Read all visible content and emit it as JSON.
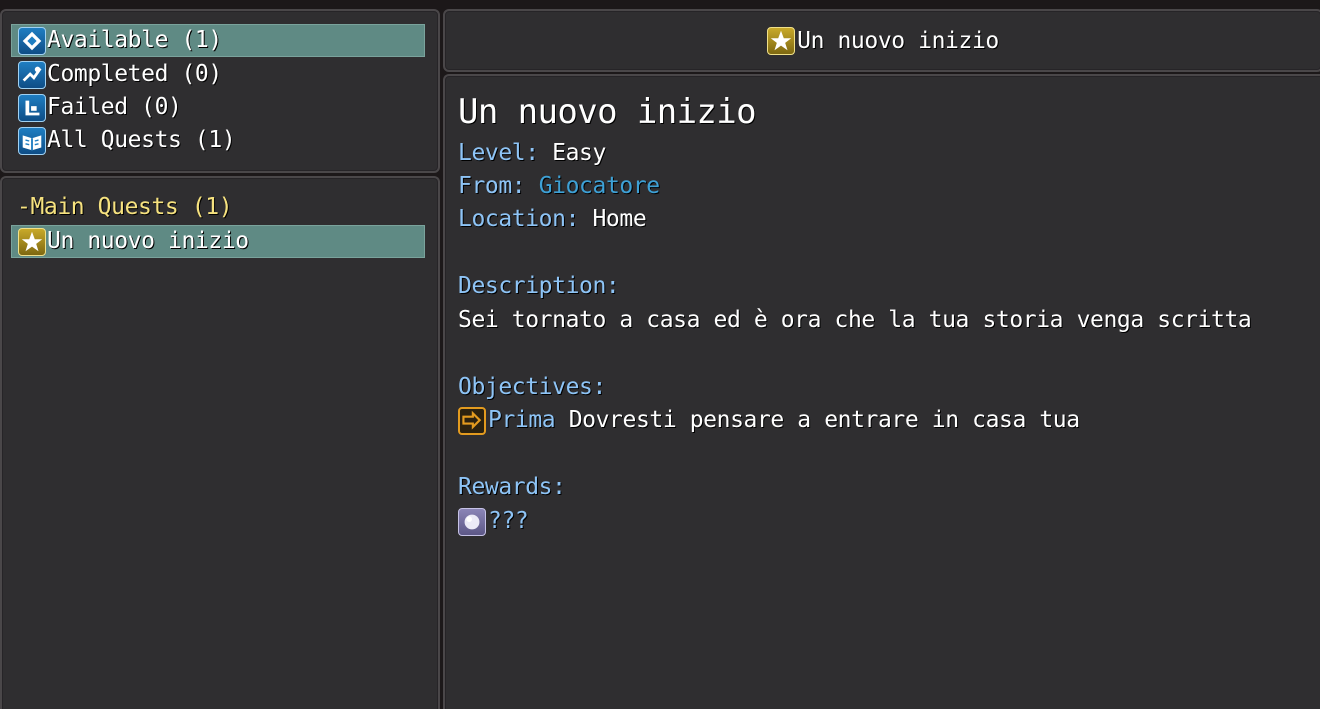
{
  "categories": [
    {
      "icon": "quest-available-icon",
      "label": "Available (1)",
      "selected": true
    },
    {
      "icon": "quest-completed-icon",
      "label": "Completed (0)",
      "selected": false
    },
    {
      "icon": "quest-failed-icon",
      "label": "Failed (0)",
      "selected": false
    },
    {
      "icon": "all-quests-book-icon",
      "label": "All Quests (1)",
      "selected": false
    }
  ],
  "quest_list": {
    "group_header": "-Main Quests (1)",
    "items": [
      {
        "icon": "star-icon",
        "label": "Un nuovo inizio",
        "selected": true
      }
    ]
  },
  "title_bar": {
    "icon": "star-icon",
    "text": "Un nuovo inizio"
  },
  "detail": {
    "title": "Un nuovo inizio",
    "level_label": "Level:",
    "level_value": "Easy",
    "from_label": "From:",
    "from_value": "Giocatore",
    "location_label": "Location:",
    "location_value": "Home",
    "description_label": "Description:",
    "description_text": "Sei tornato a casa ed è ora che la tua storia venga scritta",
    "objectives_label": "Objectives:",
    "objectives": [
      {
        "icon": "arrow-icon",
        "name": "Prima",
        "text": "Dovresti pensare a entrare in casa tua"
      }
    ],
    "rewards_label": "Rewards:",
    "rewards": [
      {
        "icon": "orb-icon",
        "text": "???"
      }
    ]
  },
  "colors": {
    "selection": "#5f8a84",
    "key_label": "#8ec4f6",
    "link": "#3ea1d6",
    "group_header": "#f6e27f",
    "window_bg": "#2f2e30"
  }
}
